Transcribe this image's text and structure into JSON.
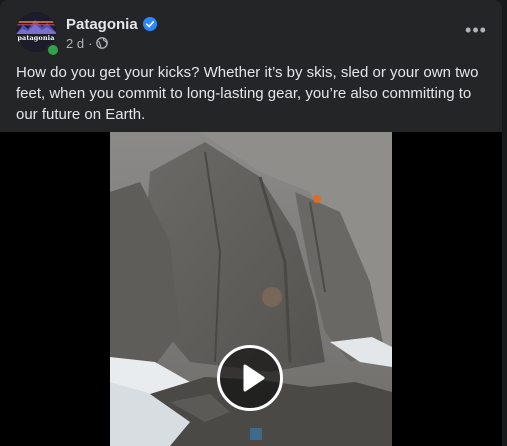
{
  "post": {
    "author": "Patagonia",
    "avatar_text": "patagonia",
    "timestamp": "2 d",
    "separator": "·",
    "more_label": "•••",
    "text": "How do you get your kicks? Whether it’s by skis, sled or your own two feet, when you commit to long-lasting gear, you’re also committing to our future on Earth."
  },
  "icons": {
    "verified": "verified-badge-icon",
    "privacy": "globe-icon",
    "more": "more-options-icon",
    "play": "play-icon"
  },
  "colors": {
    "card_bg": "#242526",
    "text_primary": "#e4e6eb",
    "text_secondary": "#b0b3b8",
    "verified_blue": "#2d88ff",
    "online_green": "#31a24c"
  }
}
